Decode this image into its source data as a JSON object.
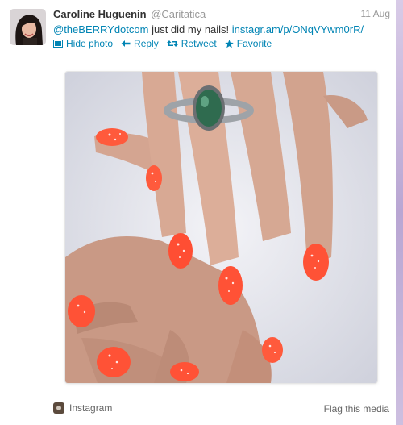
{
  "tweet": {
    "author_name": "Caroline Huguenin",
    "author_handle": "@Caritatica",
    "timestamp": "11 Aug",
    "mention": "@theBERRYdotcom",
    "body_text": " just did my nails! ",
    "link_text": "instagr.am/p/ONqVYwm0rR/"
  },
  "actions": {
    "hide_photo": "Hide photo",
    "reply": "Reply",
    "retweet": "Retweet",
    "favorite": "Favorite"
  },
  "media_footer": {
    "source": "Instagram",
    "flag": "Flag this media"
  },
  "colors": {
    "link": "#0084b4",
    "text": "#333333",
    "muted": "#999999",
    "nail_polish": "#ff5a3c"
  }
}
